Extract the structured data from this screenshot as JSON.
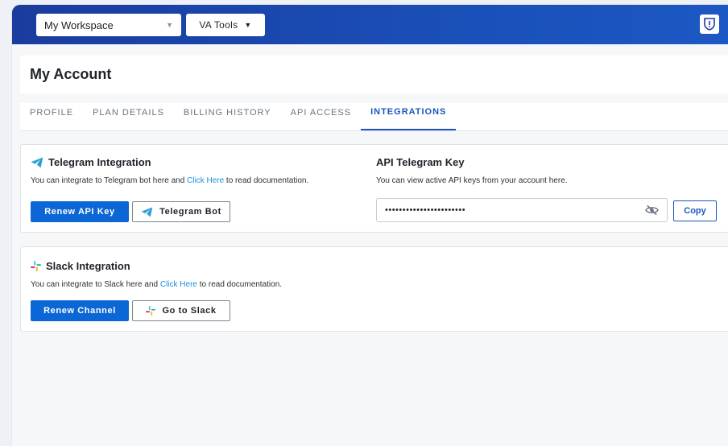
{
  "topbar": {
    "workspace_select": {
      "value": "My Workspace"
    },
    "tools_button": {
      "label": "VA Tools"
    },
    "icons": {
      "shield": "shield-icon"
    }
  },
  "page": {
    "title": "My Account"
  },
  "tabs": [
    {
      "label": "PROFILE",
      "active": false
    },
    {
      "label": "PLAN DETAILS",
      "active": false
    },
    {
      "label": "BILLING HISTORY",
      "active": false
    },
    {
      "label": "API ACCESS",
      "active": false
    },
    {
      "label": "INTEGRATIONS",
      "active": true
    }
  ],
  "telegram": {
    "title": "Telegram Integration",
    "desc_before": "You can integrate to Telegram bot here and ",
    "desc_link": "Click Here",
    "desc_after": " to read documentation.",
    "renew_label": "Renew API Key",
    "bot_label": "Telegram Bot",
    "icon": "telegram-plane-icon"
  },
  "api_key": {
    "title": "API Telegram Key",
    "desc": "You can view active API keys from your account here.",
    "masked_value": "•••••••••••••••••••••••",
    "copy_label": "Copy",
    "icon": "eye-off-icon"
  },
  "slack": {
    "title": "Slack Integration",
    "desc_before": "You can integrate to Slack here and ",
    "desc_link": "Click Here",
    "desc_after": " to read documentation.",
    "renew_label": "Renew Channel",
    "go_label": "Go to Slack",
    "icon": "slack-icon"
  },
  "colors": {
    "primary": "#0b66d6",
    "link": "#1a8fe0",
    "topbar": "#1a4fb8",
    "tab_active": "#1a55c0",
    "telegram": "#2a9fd8"
  }
}
